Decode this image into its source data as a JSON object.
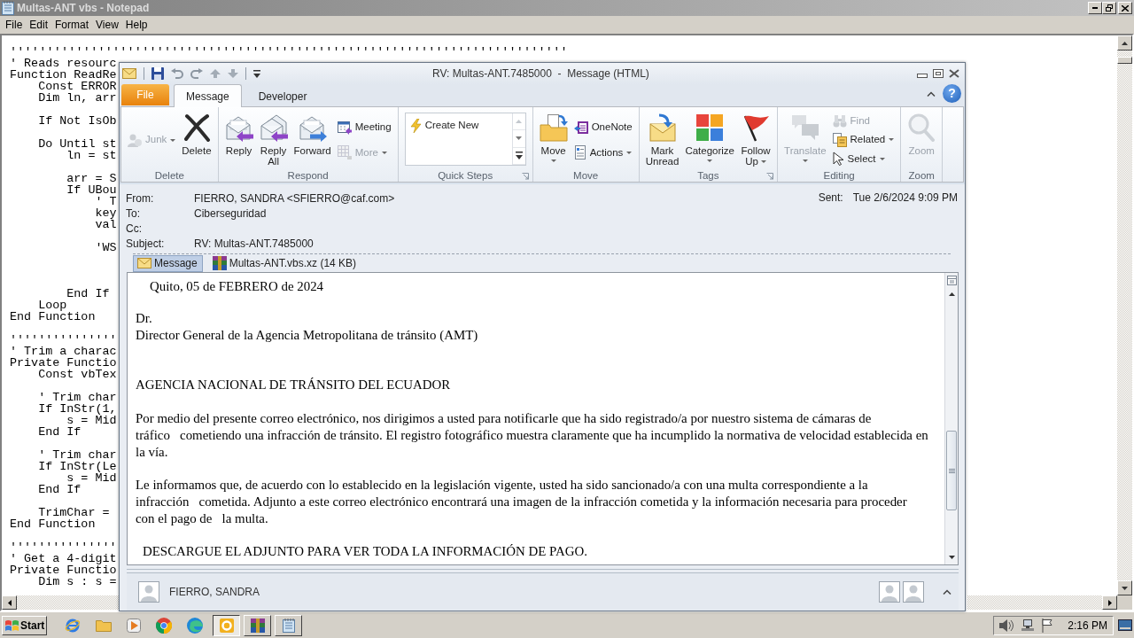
{
  "notepad": {
    "title": "Multas-ANT vbs - Notepad",
    "menu": [
      "File",
      "Edit",
      "Format",
      "View",
      "Help"
    ],
    "first_line": "''''''''''''''''''''''''''''''''''''''''''''''''''''''''''''''''''''''''''''",
    "code": "' Reads resourc\nFunction ReadRe\n    Const ERROR\n    Dim ln, arr\n\n    If Not IsOb\n\n    Do Until st\n        ln = st\n\n        arr = S\n        If UBou\n            ' T\n            key\n            val\n\n            'WS\n\n\n\n        End If\n    Loop\nEnd Function\n\n'''''''''''''''\n' Trim a charac\nPrivate Functio\n    Const vbTex\n\n    ' Trim char\n    If InStr(1,\n        s = Mid\n    End If\n\n    ' Trim char\n    If InStr(Le\n        s = Mid\n    End If\n\n    TrimChar =\nEnd Function\n\n'''''''''''''''\n' Get a 4-digit\nPrivate Functio\n    Dim s : s ="
  },
  "outlook": {
    "title": "RV: Multas-ANT.7485000  -  Message (HTML)",
    "tabs": [
      {
        "label": "File",
        "kind": "backstage",
        "selected": false
      },
      {
        "label": "Message",
        "kind": "tab",
        "selected": true
      },
      {
        "label": "Developer",
        "kind": "tab",
        "selected": false
      }
    ],
    "help": "?",
    "ribbon": [
      {
        "label": "Delete",
        "launcher": false,
        "items": [
          {
            "label": "Junk",
            "kind": "small",
            "disabled": true,
            "dropdown": true
          },
          {
            "label": "Delete",
            "kind": "large",
            "disabled": false,
            "dropdown": false
          }
        ]
      },
      {
        "label": "Respond",
        "launcher": false,
        "items": [
          {
            "label": "Reply",
            "kind": "large",
            "disabled": false,
            "dropdown": false
          },
          {
            "label": "Reply All",
            "kind": "large",
            "disabled": false,
            "dropdown": false
          },
          {
            "label": "Forward",
            "kind": "large",
            "disabled": false,
            "dropdown": false
          },
          {
            "label": "Meeting",
            "kind": "small",
            "disabled": false,
            "dropdown": false
          },
          {
            "label": "More",
            "kind": "small",
            "disabled": true,
            "dropdown": true
          }
        ]
      },
      {
        "label": "Quick Steps",
        "launcher": true,
        "items": [
          {
            "label": "Create New",
            "kind": "gallery",
            "disabled": false,
            "dropdown": false
          }
        ]
      },
      {
        "label": "Move",
        "launcher": false,
        "items": [
          {
            "label": "Move",
            "kind": "large",
            "disabled": false,
            "dropdown": true
          },
          {
            "label": "OneNote",
            "kind": "small",
            "disabled": false,
            "dropdown": false
          },
          {
            "label": "Actions",
            "kind": "small",
            "disabled": false,
            "dropdown": true
          }
        ]
      },
      {
        "label": "Tags",
        "launcher": true,
        "items": [
          {
            "label": "Mark Unread",
            "kind": "large",
            "disabled": false,
            "dropdown": false
          },
          {
            "label": "Categorize",
            "kind": "large",
            "disabled": false,
            "dropdown": true
          },
          {
            "label": "Follow Up",
            "kind": "large",
            "disabled": false,
            "dropdown": true
          }
        ]
      },
      {
        "label": "Editing",
        "launcher": false,
        "items": [
          {
            "label": "Translate",
            "kind": "large",
            "disabled": true,
            "dropdown": true
          },
          {
            "label": "Find",
            "kind": "small",
            "disabled": true,
            "dropdown": false
          },
          {
            "label": "Related",
            "kind": "small",
            "disabled": false,
            "dropdown": true
          },
          {
            "label": "Select",
            "kind": "small",
            "disabled": false,
            "dropdown": true
          }
        ]
      },
      {
        "label": "Zoom",
        "launcher": false,
        "items": [
          {
            "label": "Zoom",
            "kind": "large",
            "disabled": true,
            "dropdown": false
          }
        ]
      }
    ],
    "header": {
      "fields": [
        {
          "label": "From:",
          "value": "FIERRO, SANDRA <SFIERRO@caf.com>"
        },
        {
          "label": "To:",
          "value": "Ciberseguridad"
        },
        {
          "label": "Cc:"
        },
        {
          "label": "Subject:",
          "value": "RV: Multas-ANT.7485000"
        }
      ],
      "sent_label": "Sent:",
      "sent_value": "Tue 2/6/2024 9:09 PM"
    },
    "attachments": [
      {
        "label": "Message",
        "kind": "message",
        "selected": true
      },
      {
        "label": "Multas-ANT.vbs.xz (14 KB)",
        "kind": "archive",
        "selected": false
      }
    ],
    "body": [
      {
        "kind": "date",
        "text": "Quito, 05 de FEBRERO de 2024"
      },
      {
        "kind": "line",
        "text": "Dr."
      },
      {
        "kind": "line",
        "text": "Director General de la Agencia Metropolitana de tránsito (AMT)"
      },
      {
        "kind": "heading",
        "text": "AGENCIA NACIONAL DE TRÁNSITO DEL ECUADOR"
      },
      {
        "kind": "paragraph",
        "lines": [
          "Por medio del presente correo electrónico, nos dirigimos a usted para notificarle que ha sido registrado/a por nuestro sistema de cámaras de",
          "tráfico   cometiendo una infracción de tránsito. El registro fotográfico muestra claramente que ha incumplido la normativa de velocidad establecida en",
          "la vía."
        ]
      },
      {
        "kind": "paragraph",
        "lines": [
          "Le informamos que, de acuerdo con lo establecido en la legislación vigente, usted ha sido sancionado/a con una multa correspondiente a la",
          "infracción   cometida. Adjunto a este correo electrónico encontrará una imagen de la infracción cometida y la información necesaria para proceder",
          "con el pago de   la multa."
        ]
      },
      {
        "kind": "notice",
        "text": "DESCARGUE EL ADJUNTO PARA VER TODA LA INFORMACIÓN DE PAGO."
      }
    ],
    "people_pane": {
      "name": "FIERRO, SANDRA"
    }
  },
  "taskbar": {
    "start": "Start",
    "windows": [
      {
        "kind": "mail",
        "selected": true
      },
      {
        "kind": "archive",
        "selected": false
      },
      {
        "kind": "notepad",
        "selected": false
      }
    ],
    "clock": "2:16 PM"
  }
}
